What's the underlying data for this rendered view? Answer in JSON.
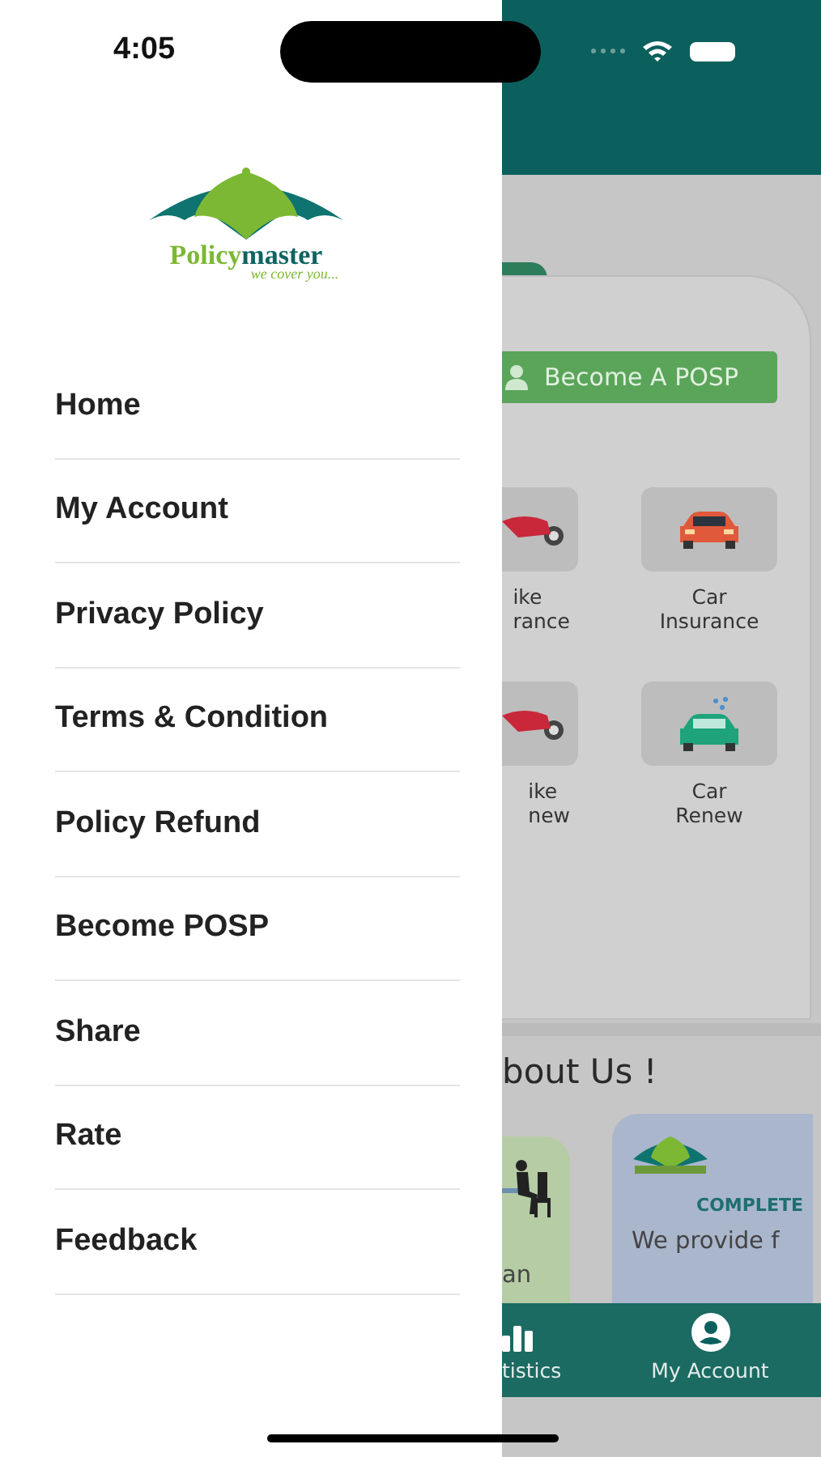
{
  "status_bar": {
    "time": "4:05"
  },
  "drawer": {
    "logo": {
      "word_1": "Policy",
      "word_2": "master",
      "tagline": "we cover you..."
    },
    "items": [
      {
        "label": "Home"
      },
      {
        "label": "My Account"
      },
      {
        "label": "Privacy Policy"
      },
      {
        "label": "Terms & Condition"
      },
      {
        "label": "Policy Refund"
      },
      {
        "label": "Become POSP"
      },
      {
        "label": "Share"
      },
      {
        "label": "Rate"
      },
      {
        "label": "Feedback"
      }
    ]
  },
  "home": {
    "posp_button": "Become A POSP",
    "services": [
      {
        "kind": "bike",
        "lines": [
          "ike",
          "rance"
        ]
      },
      {
        "kind": "car",
        "lines": [
          "Car",
          "Insurance"
        ]
      },
      {
        "kind": "bike",
        "lines": [
          "ike",
          "new"
        ]
      },
      {
        "kind": "car_renew",
        "lines": [
          "Car",
          "Renew"
        ]
      }
    ],
    "about_title": "bout Us !",
    "about_cards": [
      {
        "kind": "office",
        "text": "an"
      },
      {
        "kind": "brand",
        "heading": "COMPLETE",
        "text": "We provide f"
      }
    ]
  },
  "bottom_nav": [
    {
      "kind": "stats",
      "label": "tistics"
    },
    {
      "kind": "account",
      "label": "My Account"
    }
  ]
}
